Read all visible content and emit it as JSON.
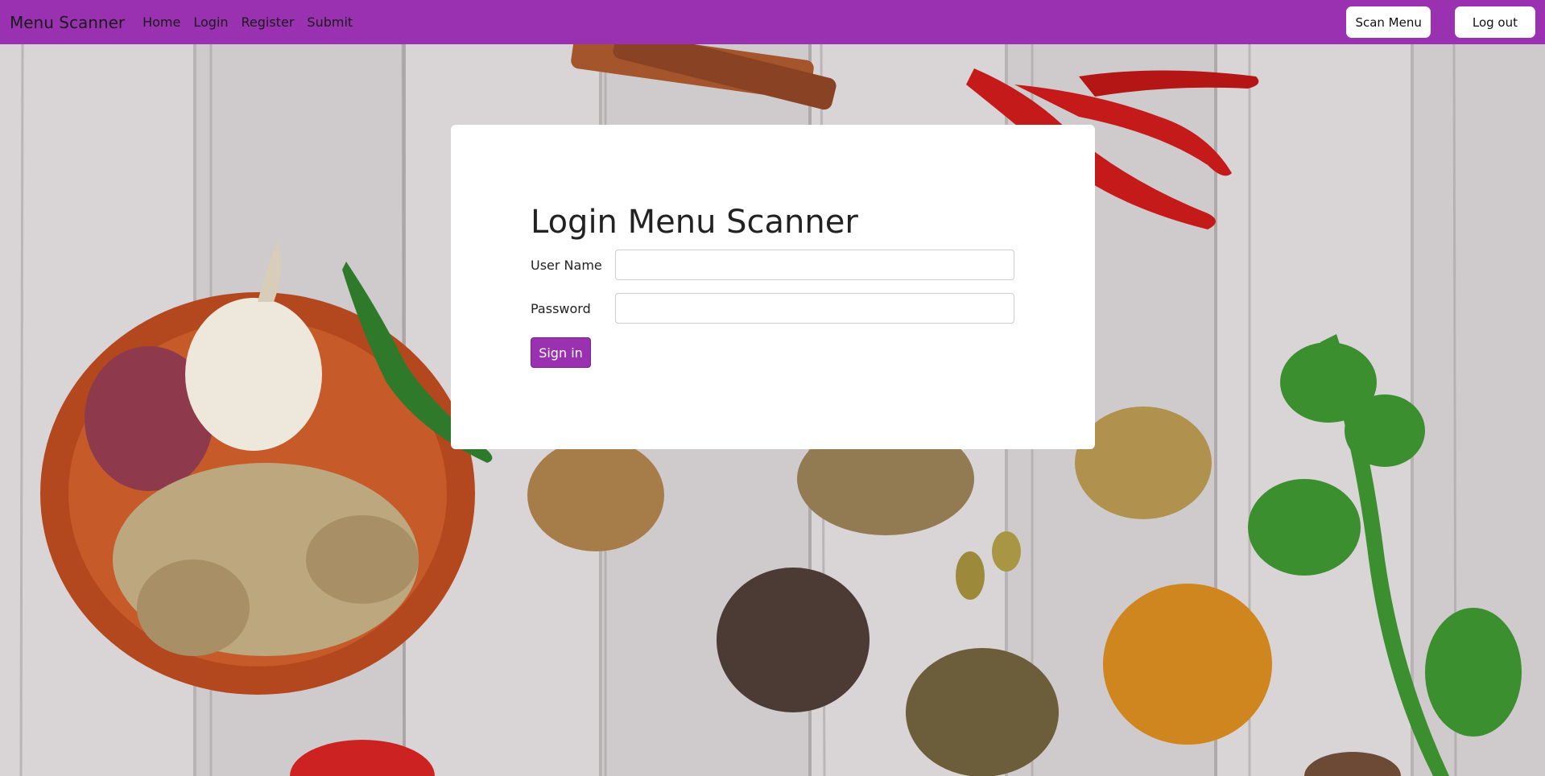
{
  "navbar": {
    "brand": "Menu Scanner",
    "links": [
      "Home",
      "Login",
      "Register",
      "Submit"
    ],
    "scan_button": "Scan Menu",
    "logout_button": "Log out",
    "color": "#9a31b1"
  },
  "login": {
    "title": "Login Menu Scanner",
    "username_label": "User Name",
    "username_value": "",
    "password_label": "Password",
    "password_value": "",
    "signin_button": "Sign in"
  },
  "background": {
    "icon": "spices-photo"
  }
}
